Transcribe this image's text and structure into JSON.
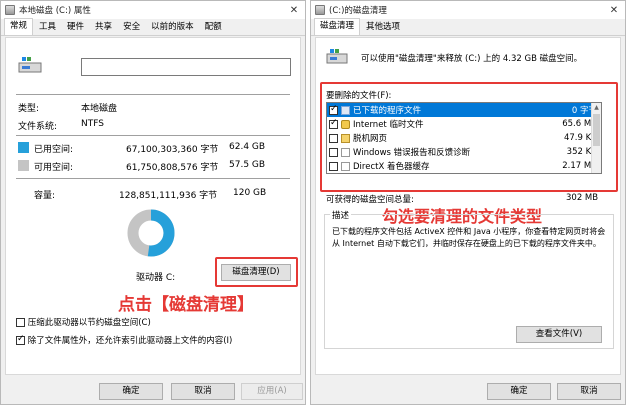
{
  "left": {
    "title": "本地磁盘 (C:) 属性",
    "tabs": [
      "常规",
      "工具",
      "硬件",
      "共享",
      "安全",
      "以前的版本",
      "配额"
    ],
    "type_label": "类型:",
    "type_value": "本地磁盘",
    "fs_label": "文件系统:",
    "fs_value": "NTFS",
    "used_label": "已用空间:",
    "used_bytes": "67,100,303,360 字节",
    "used_gb": "62.4 GB",
    "free_label": "可用空间:",
    "free_bytes": "61,750,808,576 字节",
    "free_gb": "57.5 GB",
    "capacity_label": "容量:",
    "capacity_bytes": "128,851,111,936 字节",
    "capacity_gb": "120 GB",
    "drive_label": "驱动器 C:",
    "cleanup_button": "磁盘清理(D)",
    "annotation": "点击【磁盘清理】",
    "compress_option": "压缩此驱动器以节约磁盘空间(C)",
    "index_option": "除了文件属性外，还允许索引此驱动器上文件的内容(I)",
    "ok": "确定",
    "cancel": "取消",
    "apply": "应用(A)",
    "used_fraction": 0.521,
    "colors": {
      "used": "#26a0da",
      "free": "#c4c4c4"
    }
  },
  "right": {
    "title": "(C:)的磁盘清理",
    "tabs": [
      "磁盘清理",
      "其他选项"
    ],
    "intro": "可以使用\"磁盘清理\"来释放 (C:) 上的 4.32 GB 磁盘空间。",
    "files_label": "要删除的文件(F):",
    "files": [
      {
        "name": "已下载的程序文件",
        "size": "0 字节",
        "checked": true,
        "selected": true
      },
      {
        "name": "Internet 临时文件",
        "size": "65.6 MB",
        "checked": true,
        "selected": false
      },
      {
        "name": "脱机网页",
        "size": "47.9 KB",
        "checked": false,
        "selected": false
      },
      {
        "name": "Windows 错误报告和反馈诊断",
        "size": "352 KB",
        "checked": false,
        "selected": false
      },
      {
        "name": "DirectX 着色器缓存",
        "size": "2.17 MB",
        "checked": false,
        "selected": false
      }
    ],
    "total_label": "可获得的磁盘空间总量:",
    "total_value": "302 MB",
    "annotation": "勾选要清理的文件类型",
    "desc_label": "描述",
    "description": "已下载的程序文件包括 ActiveX 控件和 Java 小程序，你查看特定网页时将会从 Internet 自动下载它们，并临时保存在硬盘上的已下载的程序文件夹中。",
    "view_files": "查看文件(V)",
    "ok": "确定",
    "cancel": "取消"
  }
}
